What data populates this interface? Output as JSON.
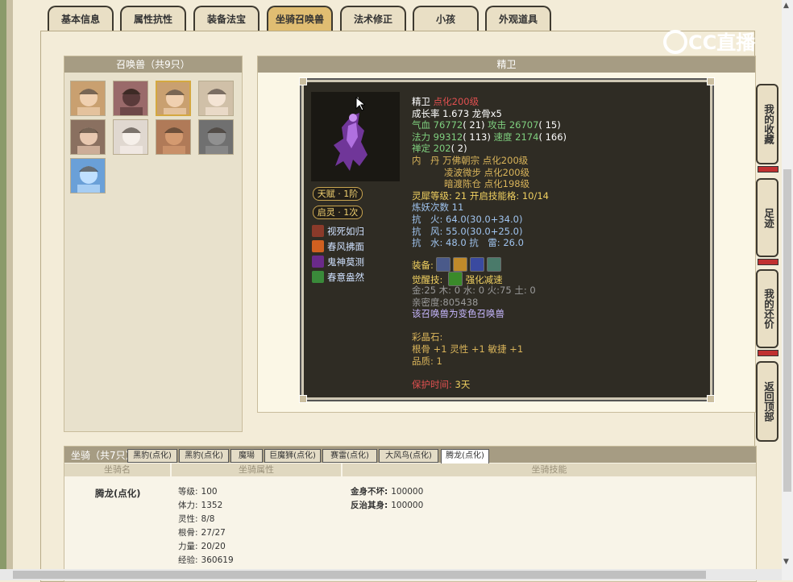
{
  "tabs": [
    {
      "label": "基本信息",
      "active": false
    },
    {
      "label": "属性抗性",
      "active": false
    },
    {
      "label": "装备法宝",
      "active": false
    },
    {
      "label": "坐骑召唤兽",
      "active": true
    },
    {
      "label": "法术修正",
      "active": false
    },
    {
      "label": "小孩",
      "active": false
    },
    {
      "label": "外观道具",
      "active": false
    }
  ],
  "watermark": "CC直播",
  "summons_panel": {
    "title": "召唤兽（共9只）"
  },
  "detail_panel": {
    "title": "精卫"
  },
  "pet": {
    "name": "精卫",
    "transform": "点化200级",
    "growth": "成长率 1.673 龙骨x5",
    "hp_label": "气血",
    "hp": "76772",
    "hp_plus": "( 21)",
    "atk_label": "攻击",
    "atk": "26707",
    "atk_plus": "( 15)",
    "mp_label": "法力",
    "mp": "99312",
    "mp_plus": "( 113)",
    "spd_label": "速度",
    "spd": "2174",
    "spd_plus": "( 166)",
    "zen_label": "禅定",
    "zen": "202",
    "zen_plus": "( 2)",
    "dan_label": "内　丹",
    "dan1": "万佛朝宗 点化200级",
    "dan2": "凌波微步 点化200级",
    "dan3": "暗渡陈仓 点化198级",
    "soul_label": "灵犀等级:",
    "soul_val": "21",
    "soul_grid_label": "开启技能格:",
    "soul_grid": "10/14",
    "refine": "炼妖次数 11",
    "res_fire": "抗　火: 64.0(30.0+34.0)",
    "res_wind": "抗　风: 55.0(30.0+25.0)",
    "res_water": "抗　水: 48.0 抗　雷: 26.0",
    "equip_label": "装备:",
    "awake_label": "觉醒技:",
    "awake_skill": "强化减速",
    "elements": "金:25 木: 0 水: 0 火:75 土: 0",
    "intimacy": "亲密度:805438",
    "variant": "该召唤兽为变色召唤兽",
    "gem_label": "彩晶石:",
    "gem_stats": "根骨 +1 灵性 +1 敏捷 +1",
    "quality": "品质: 1",
    "protect_label": "保护时间:",
    "protect_val": "3天"
  },
  "badges": {
    "talent": "天赋 · 1阶",
    "qiling": "启灵 · 1次"
  },
  "pet_skills": [
    {
      "name": "视死如归",
      "color": "#8a3a2a"
    },
    {
      "name": "春风拂面",
      "color": "#d06020"
    },
    {
      "name": "鬼神莫测",
      "color": "#6a2a8a"
    },
    {
      "name": "春意盎然",
      "color": "#3a8a3a"
    }
  ],
  "equip_colors": [
    "#4a5a8a",
    "#c08a2a",
    "#3a4aa0",
    "#4a7a6a"
  ],
  "side_buttons": [
    "我的收藏",
    "足迹",
    "我的还价",
    "返回顶部"
  ],
  "mount": {
    "title": "坐骑（共7只）",
    "tabs": [
      "黑豹(点化)",
      "黑豹(点化)",
      "魔瑒",
      "巨魔狮(点化)",
      "赛雷(点化)",
      "大风鸟(点化)",
      "腾龙(点化)"
    ],
    "active_tab": 6,
    "col_name": "坐骑名",
    "col_attr": "坐骑属性",
    "col_skill": "坐骑技能",
    "name": "腾龙(点化)",
    "attrs": [
      {
        "label": "等级:",
        "value": "100"
      },
      {
        "label": "体力:",
        "value": "1352"
      },
      {
        "label": "灵性:",
        "value": "8/8"
      },
      {
        "label": "根骨:",
        "value": "27/27"
      },
      {
        "label": "力量:",
        "value": "20/20"
      },
      {
        "label": "经验:",
        "value": "360619"
      }
    ],
    "skills": [
      {
        "label": "金身不坏:",
        "value": "100000"
      },
      {
        "label": "反治其身:",
        "value": "100000"
      }
    ]
  }
}
